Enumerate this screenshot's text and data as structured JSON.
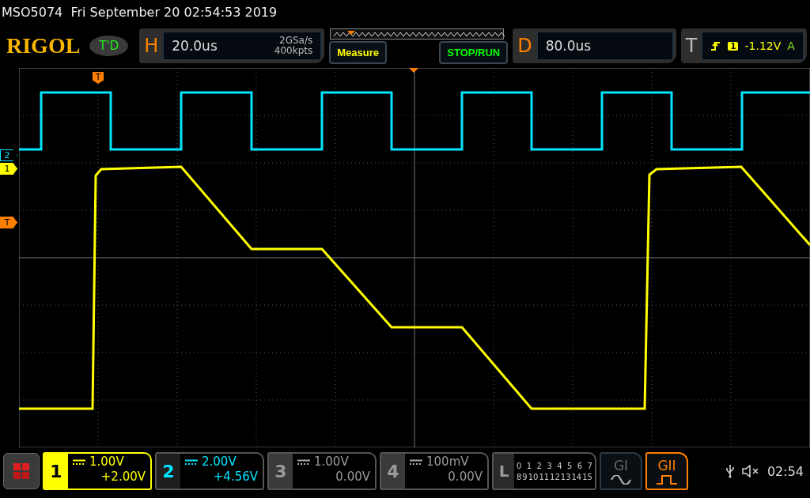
{
  "title_bar": {
    "text": "MSO5074  Fri September 20 02:54:53 2019"
  },
  "logo": "RIGOL",
  "run_state": "T'D",
  "horizontal": {
    "label": "H",
    "scale": "20.0us",
    "sample_rate": "2GSa/s",
    "memory_depth": "400kpts"
  },
  "buttons": [
    {
      "label": "Measure",
      "color": "#ffff00"
    },
    {
      "label": "STOP/RUN",
      "color": "#00ff00"
    }
  ],
  "delay": {
    "label": "D",
    "value": "80.0us"
  },
  "trigger": {
    "label": "T",
    "source": "1",
    "level": "-1.12V",
    "mode": "A"
  },
  "screen_markers": [
    {
      "label": "2",
      "color": "#00e5ff"
    },
    {
      "label": "1",
      "color": "#ffff00"
    },
    {
      "label": "T",
      "color": "#ff8000"
    }
  ],
  "trigger_position_marker": "T",
  "channels": [
    {
      "number": "1",
      "scale": "1.00V",
      "offset": "+2.00V",
      "color": "#ffff00",
      "on": true,
      "selected": true
    },
    {
      "number": "2",
      "scale": "2.00V",
      "offset": "+4.56V",
      "color": "#00e5ff",
      "on": true,
      "selected": false
    },
    {
      "number": "3",
      "scale": "1.00V",
      "offset": "0.00V",
      "color": "#9a9a9a",
      "on": false,
      "selected": false
    },
    {
      "number": "4",
      "scale": "100mV",
      "offset": "0.00V",
      "color": "#9a9a9a",
      "on": false,
      "selected": false
    }
  ],
  "logic": {
    "label": "L",
    "row_1": [
      "0",
      "1",
      "2",
      "3",
      "4",
      "5",
      "6",
      "7"
    ],
    "row_2": [
      "8",
      "9",
      "10",
      "11",
      "12",
      "13",
      "14",
      "15"
    ]
  },
  "generators": [
    {
      "label": "GI",
      "kind": "sine",
      "on": false
    },
    {
      "label": "GII",
      "kind": "square",
      "on": true
    }
  ],
  "status": {
    "time": "02:54"
  }
}
